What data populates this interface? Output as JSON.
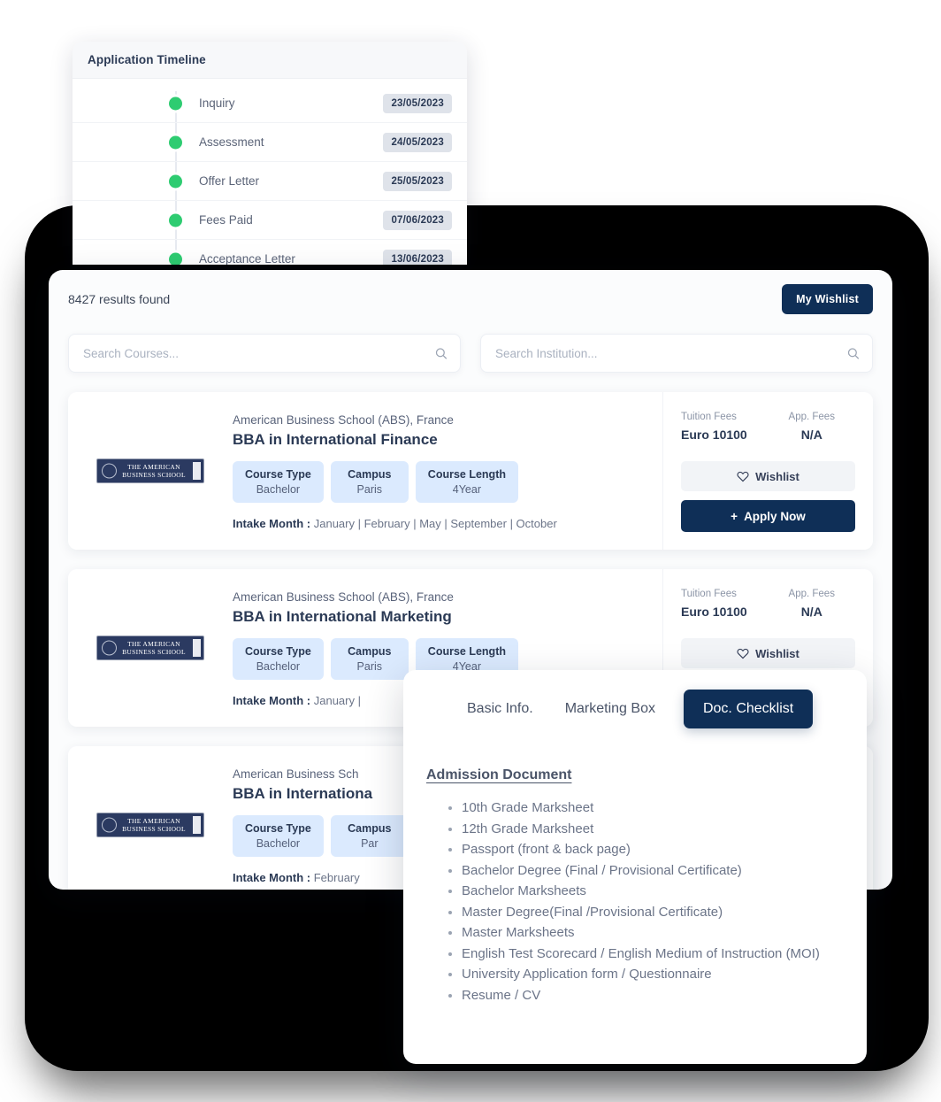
{
  "timeline": {
    "title": "Application Timeline",
    "rows": [
      {
        "label": "Inquiry",
        "date": "23/05/2023"
      },
      {
        "label": "Assessment",
        "date": "24/05/2023"
      },
      {
        "label": "Offer Letter",
        "date": "25/05/2023"
      },
      {
        "label": "Fees Paid",
        "date": "07/06/2023"
      },
      {
        "label": "Acceptance Letter",
        "date": "13/06/2023"
      }
    ]
  },
  "results": {
    "count_text": "8427 results found",
    "wishlist_button": "My Wishlist",
    "search_courses": {
      "value": "",
      "placeholder": "Search Courses..."
    },
    "search_institution": {
      "value": "",
      "placeholder": "Search Institution..."
    }
  },
  "logo": {
    "line1": "THE AMERICAN",
    "line2": "BUSINESS SCHOOL"
  },
  "labels": {
    "course_type": "Course Type",
    "campus": "Campus",
    "course_length": "Course Length",
    "intake_prefix": "Intake Month :",
    "tuition_fees": "Tuition Fees",
    "app_fees": "App. Fees",
    "wishlist": "Wishlist",
    "apply_now": "Apply Now",
    "plus": "+"
  },
  "cards": [
    {
      "institution": "American Business School (ABS), France",
      "title": "BBA in International Finance",
      "course_type": "Bachelor",
      "campus": "Paris",
      "course_length": "4Year",
      "intake_months": "January | February | May | September | October",
      "tuition_fees": "Euro 10100",
      "app_fees": "N/A"
    },
    {
      "institution": "American Business School (ABS), France",
      "title": "BBA in International Marketing",
      "course_type": "Bachelor",
      "campus": "Paris",
      "course_length": "4Year",
      "intake_months": "January |",
      "tuition_fees": "Euro 10100",
      "app_fees": "N/A"
    },
    {
      "institution": "American Business Sch",
      "title": "BBA in Internationa",
      "course_type": "Bachelor",
      "campus": "Par",
      "course_length": "",
      "intake_months": "February",
      "tuition_fees": "",
      "app_fees": ""
    }
  ],
  "popup": {
    "tabs": [
      {
        "label": "Basic Info.",
        "active": false
      },
      {
        "label": "Marketing Box",
        "active": false
      },
      {
        "label": "Doc. Checklist",
        "active": true
      }
    ],
    "section_title": "Admission Document",
    "documents": [
      "10th Grade Marksheet",
      "12th Grade Marksheet",
      "Passport (front & back page)",
      "Bachelor Degree (Final / Provisional Certificate)",
      "Bachelor Marksheets",
      "Master Degree(Final /Provisional Certificate)",
      "Master Marksheets",
      "English Test Scorecard / English Medium of Instruction (MOI)",
      "University Application form / Questionnaire",
      "Resume / CV"
    ]
  },
  "colors": {
    "navy": "#0f2f57",
    "green": "#2ecc71",
    "chip_blue": "#dbeafe",
    "badge_gray": "#dfe3ea",
    "backdrop": "#000000"
  }
}
